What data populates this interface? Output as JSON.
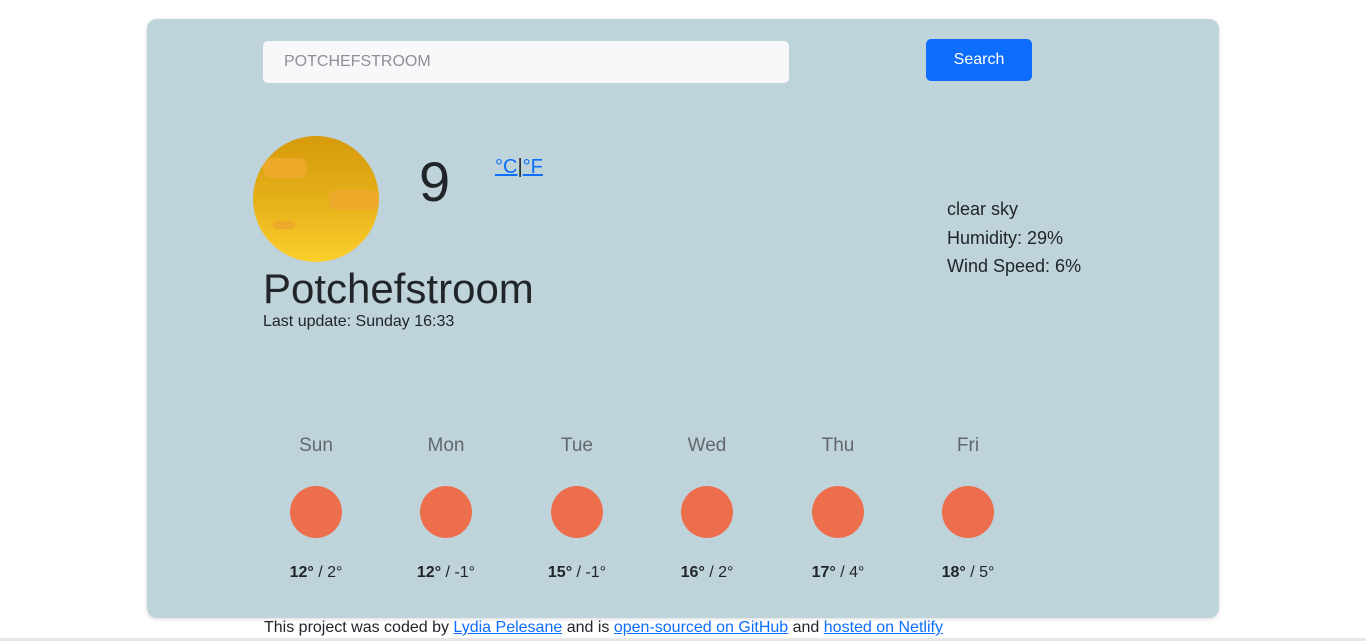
{
  "search": {
    "value": "",
    "placeholder": "POTCHEFSTROOM",
    "button_label": "Search"
  },
  "current": {
    "icon": "sun-haze-icon",
    "temperature": "9",
    "unit_celsius": "°C",
    "unit_separator": "|",
    "unit_fahrenheit": "°F",
    "city": "Potchefstroom",
    "last_update": "Last update: Sunday 16:33",
    "description": "clear sky",
    "humidity": "Humidity: 29%",
    "wind_speed": "Wind Speed: 6%"
  },
  "forecast": [
    {
      "day": "Sun",
      "icon": "sun-icon",
      "max": "12°",
      "min": " / 2°"
    },
    {
      "day": "Mon",
      "icon": "sun-icon",
      "max": "12°",
      "min": " / -1°"
    },
    {
      "day": "Tue",
      "icon": "sun-icon",
      "max": "15°",
      "min": " / -1°"
    },
    {
      "day": "Wed",
      "icon": "sun-icon",
      "max": "16°",
      "min": " / 2°"
    },
    {
      "day": "Thu",
      "icon": "sun-icon",
      "max": "17°",
      "min": " / 4°"
    },
    {
      "day": "Fri",
      "icon": "sun-icon",
      "max": "18°",
      "min": " / 5°"
    }
  ],
  "footer": {
    "text_1": "This project was coded by ",
    "author_link": "Lydia Pelesane",
    "text_2": " and is ",
    "github_link": "open-sourced on GitHub",
    "text_3": " and ",
    "netlify_link": "hosted on Netlify"
  },
  "colors": {
    "card_background": "#bfd3db",
    "accent": "#0d6efd",
    "forecast_icon": "#ec6e4c",
    "current_icon_top": "#d69a0c",
    "current_icon_bottom": "#fbcf2d"
  }
}
